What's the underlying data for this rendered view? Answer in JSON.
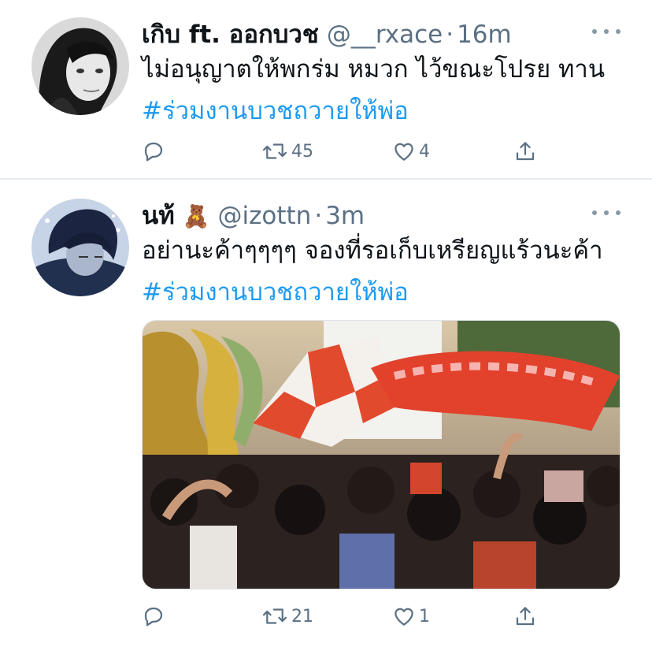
{
  "tweets": [
    {
      "name": "เกิบ ft. ออกบวช",
      "name_emoji": "",
      "handle": "@__rxace",
      "dot": "·",
      "time": "16m",
      "text_plain": "ไม่อนุญาตให้พกร่ม หมวก ไว้ขณะโปรย ทาน ",
      "hashtag": "#ร่วมงานบวชถวายให้พ่อ",
      "reply_count": "",
      "retweet_count": "45",
      "like_count": "4"
    },
    {
      "name": "นท้",
      "name_emoji": "🧸",
      "handle": "@izottn",
      "dot": "·",
      "time": "3m",
      "text_plain": "อย่านะค้าๆๆๆๆ จองที่รอเก็บเหรียญแร้วนะค้า  ",
      "hashtag": "#ร่วมงานบวชถวายให้พ่อ",
      "reply_count": "",
      "retweet_count": "21",
      "like_count": "1"
    }
  ],
  "icons": {
    "reply": "reply-icon",
    "retweet": "retweet-icon",
    "like": "heart-icon",
    "share": "share-icon",
    "more": "more-icon"
  },
  "colors": {
    "hashtag": "#1d9bf0",
    "secondary_text": "#5b7083",
    "divider": "#e6ecf0"
  }
}
